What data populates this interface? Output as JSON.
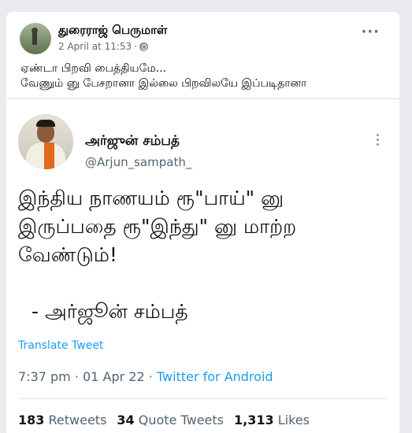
{
  "fb_post": {
    "author": "துரைராஜ் பெருமாள்",
    "date": "2 April at 11:53",
    "separator": "·",
    "more_icon": "more-horizontal-icon",
    "privacy_icon": "globe-icon",
    "text_line1": "ஏண்டா பிறவி பைத்தியமே...",
    "text_line2": "வேணும் னு பேசறானா இல்லை பிறவிலயே இப்படிதானா"
  },
  "tweet": {
    "author_name": "அர்ஜுன் சம்பத்",
    "handle": "@Arjun_sampath_",
    "body": "இந்திய நாணயம் ரூ\"பாய்\" னு\nஇருப்பதை ரூ\"இந்து\" னு மாற்ற\nவேண்டும்!",
    "signature": "- அர்ஜூன் சம்பத்",
    "translate_label": "Translate Tweet",
    "time": "7:37 pm",
    "meta_sep": "·",
    "date": "01 Apr 22",
    "source": "Twitter for Android",
    "stats": {
      "retweets_count": "183",
      "retweets_label": "Retweets",
      "quotes_count": "34",
      "quotes_label": "Quote Tweets",
      "likes_count": "1,313",
      "likes_label": "Likes"
    }
  },
  "colors": {
    "facebook_bg": "#e9ebee",
    "twitter_blue": "#1d9bf0",
    "muted": "#536471"
  }
}
